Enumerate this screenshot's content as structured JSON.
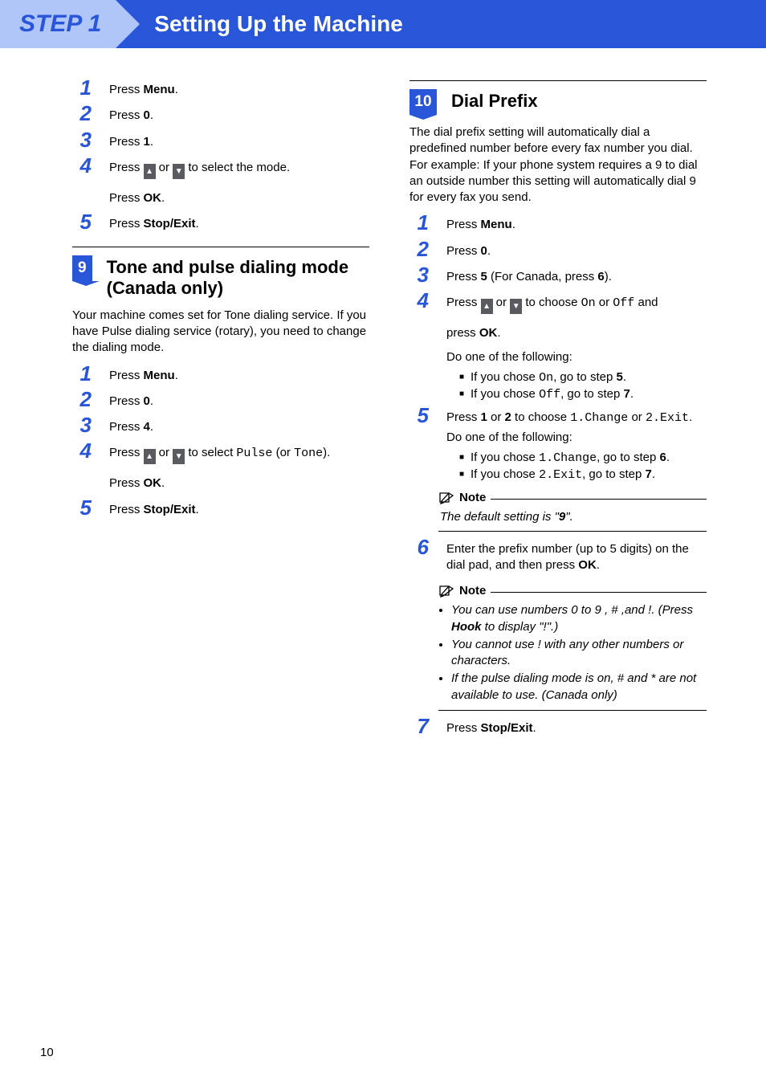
{
  "header": {
    "step": "STEP 1",
    "title": "Setting Up the Machine"
  },
  "colA": {
    "steps1": [
      {
        "n": "1",
        "text": "Press ",
        "bold": "Menu",
        "after": "."
      },
      {
        "n": "2",
        "text": "Press ",
        "bold": "0",
        "after": "."
      },
      {
        "n": "3",
        "text": "Press ",
        "bold": "1",
        "after": "."
      }
    ],
    "s4_pre": "Press ",
    "s4_or": " or ",
    "s4_post": " to select the mode.",
    "s4_ok_pre": "Press ",
    "s4_ok": "OK",
    "s4_ok_post": ".",
    "s5_pre": "Press ",
    "s5_bold": "Stop/Exit",
    "s5_post": ".",
    "sec9": {
      "num": "9",
      "title": "Tone and pulse dialing mode (Canada only)"
    },
    "intro9": "Your machine comes set for Tone dialing service. If you have Pulse dialing service (rotary), you need to change the dialing mode.",
    "steps2": [
      {
        "n": "1",
        "text": "Press ",
        "bold": "Menu",
        "after": "."
      },
      {
        "n": "2",
        "text": "Press ",
        "bold": "0",
        "after": "."
      },
      {
        "n": "3",
        "text": "Press ",
        "bold": "4",
        "after": "."
      }
    ],
    "s4b_pre": "Press ",
    "s4b_or": " or ",
    "s4b_mid": " to select ",
    "s4b_pulse": "Pulse",
    "s4b_paren": " (or ",
    "s4b_tone": "Tone",
    "s4b_end": ").",
    "s4b_ok_pre": "Press ",
    "s4b_ok": "OK",
    "s4b_ok_post": ".",
    "s5b_pre": "Press ",
    "s5b_bold": "Stop/Exit",
    "s5b_post": "."
  },
  "colB": {
    "sec10": {
      "num": "10",
      "title": "Dial Prefix"
    },
    "intro10": "The dial prefix setting will automatically dial a predefined number before every fax number you dial. For example: If your phone system requires a 9 to dial an outside number this setting will automatically dial 9 for every fax you send.",
    "steps3": [
      {
        "n": "1",
        "text": "Press ",
        "bold": "Menu",
        "after": "."
      },
      {
        "n": "2",
        "text": "Press ",
        "bold": "0",
        "after": "."
      }
    ],
    "s3c_pre": "Press ",
    "s3c_bold": "5",
    "s3c_mid": " (For Canada, press ",
    "s3c_bold2": "6",
    "s3c_end": ").",
    "s4c_pre": "Press ",
    "s4c_or": " or ",
    "s4c_mid": " to choose ",
    "s4c_on": "On",
    "s4c_or2": " or ",
    "s4c_off": "Off",
    "s4c_and": " and",
    "s4c_press": "press ",
    "s4c_ok": "OK",
    "s4c_dot": ".",
    "s4c_do": "Do one of the following:",
    "s4c_b1_a": "If you chose ",
    "s4c_b1_on": "On",
    "s4c_b1_b": ", go to step ",
    "s4c_b1_c": "5",
    "s4c_b1_d": ".",
    "s4c_b2_a": "If you chose ",
    "s4c_b2_off": "Off",
    "s4c_b2_b": ", go to step ",
    "s4c_b2_c": "7",
    "s4c_b2_d": ".",
    "s5c_a": "Press ",
    "s5c_b": "1",
    "s5c_c": " or ",
    "s5c_d": "2",
    "s5c_e": " to choose ",
    "s5c_f": "1.Change",
    "s5c_g": " or ",
    "s5c_h": "2.Exit",
    "s5c_i": ".",
    "s5c_do": "Do one of the following:",
    "s5c_b1_a": "If you chose ",
    "s5c_b1_b": "1.Change",
    "s5c_b1_c": ", go to step ",
    "s5c_b1_d": "6",
    "s5c_b1_e": ".",
    "s5c_b2_a": "If you chose ",
    "s5c_b2_b": "2.Exit",
    "s5c_b2_c": ", go to step ",
    "s5c_b2_d": "7",
    "s5c_b2_e": ".",
    "note1_label": "Note",
    "note1_text_a": "The default setting is \"",
    "note1_text_b": "9",
    "note1_text_c": "\".",
    "s6_a": "Enter the prefix number (up to 5 digits) on the dial pad, and then press ",
    "s6_b": "OK",
    "s6_c": ".",
    "note2_label": "Note",
    "note2_li1_a": "You can use numbers 0 to 9 , # ,and !. (Press ",
    "note2_li1_b": "Hook",
    "note2_li1_c": " to display \"!\".)",
    "note2_li2": "You cannot use ! with any other numbers or characters.",
    "note2_li3": "If the pulse dialing mode is on, # and * are not available to use. (Canada only)",
    "s7_a": "Press ",
    "s7_b": "Stop/Exit",
    "s7_c": "."
  },
  "pagenum": "10"
}
